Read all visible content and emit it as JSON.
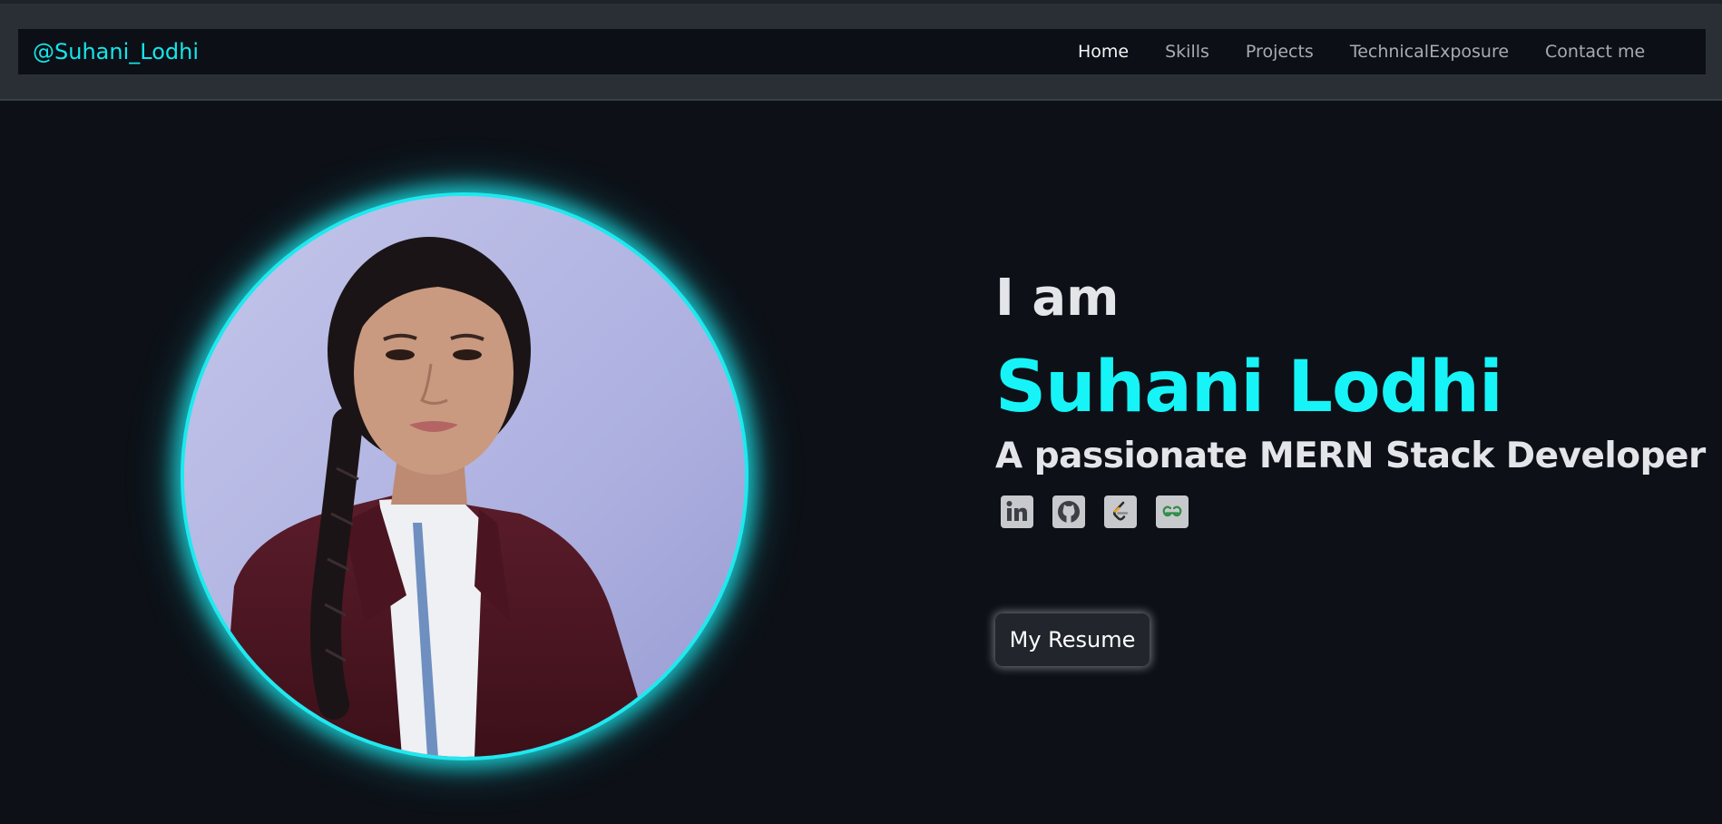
{
  "navbar": {
    "brand": "@Suhani_Lodhi",
    "links": [
      {
        "label": "Home",
        "active": true
      },
      {
        "label": "Skills",
        "active": false
      },
      {
        "label": "Projects",
        "active": false
      },
      {
        "label": "TechnicalExposure",
        "active": false
      },
      {
        "label": "Contact me",
        "active": false
      }
    ]
  },
  "hero": {
    "intro": "I am",
    "name": "Suhani Lodhi",
    "tagline": "A passionate MERN Stack Developer",
    "social_icons": [
      "linkedin-icon",
      "github-icon",
      "leetcode-icon",
      "geeksforgeeks-icon"
    ],
    "resume_button": "My Resume"
  },
  "colors": {
    "accent": "#14e6ea",
    "background": "#0d1017",
    "navbar": "#0c0f16",
    "text": "#e3e5e8"
  }
}
